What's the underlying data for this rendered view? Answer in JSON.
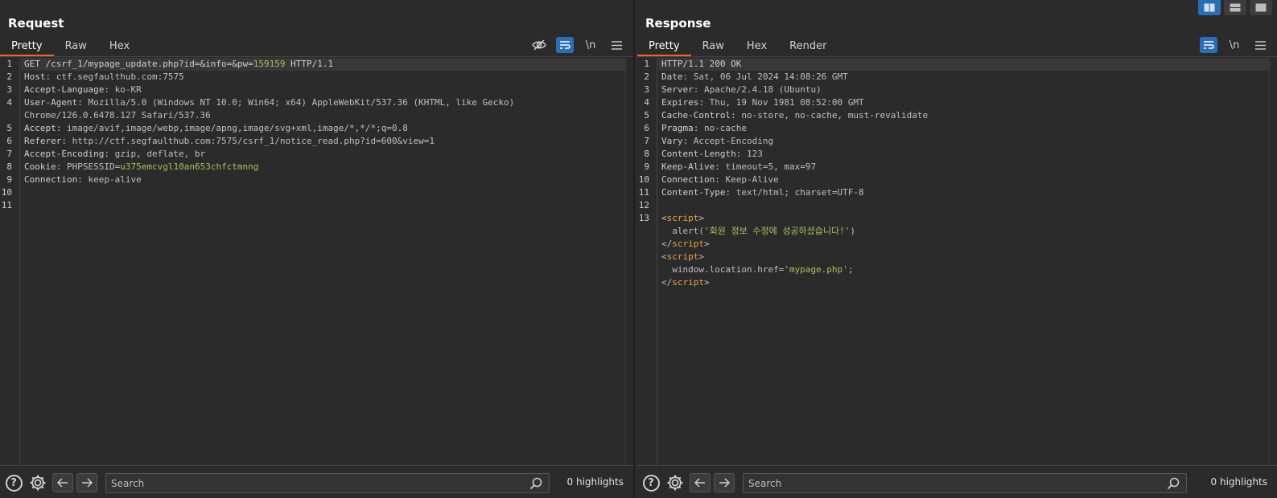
{
  "request": {
    "title": "Request",
    "tabs": [
      "Pretty",
      "Raw",
      "Hex"
    ],
    "active_tab": "Pretty",
    "lines": [
      {
        "n": "1",
        "parts": [
          [
            "k",
            "GET /csrf_1/mypage_update.php?id=&info=&pw="
          ],
          [
            "g",
            "159159"
          ],
          [
            "k",
            " HTTP/1.1"
          ]
        ]
      },
      {
        "n": "2",
        "parts": [
          [
            "k",
            "Host"
          ],
          [
            "v",
            ": ctf.segfaulthub.com:7575"
          ]
        ]
      },
      {
        "n": "3",
        "parts": [
          [
            "k",
            "Accept-Language"
          ],
          [
            "v",
            ": ko-KR"
          ]
        ]
      },
      {
        "n": "4",
        "parts": [
          [
            "k",
            "User-Agent"
          ],
          [
            "v",
            ": Mozilla/5.0 (Windows NT 10.0; Win64; x64) AppleWebKit/537.36 (KHTML, like Gecko)"
          ]
        ]
      },
      {
        "n": "",
        "parts": [
          [
            "v",
            "Chrome/126.0.6478.127 Safari/537.36"
          ]
        ]
      },
      {
        "n": "5",
        "parts": [
          [
            "k",
            "Accept"
          ],
          [
            "v",
            ": image/avif,image/webp,image/apng,image/svg+xml,image/*,*/*;q=0.8"
          ]
        ]
      },
      {
        "n": "6",
        "parts": [
          [
            "k",
            "Referer"
          ],
          [
            "v",
            ": http://ctf.segfaulthub.com:7575/csrf_1/notice_read.php?id=600&view=1"
          ]
        ]
      },
      {
        "n": "7",
        "parts": [
          [
            "k",
            "Accept-Encoding"
          ],
          [
            "v",
            ": gzip, deflate, br"
          ]
        ]
      },
      {
        "n": "8",
        "parts": [
          [
            "k",
            "Cookie"
          ],
          [
            "v",
            ": PHPSESSID="
          ],
          [
            "g",
            "u375emcvgl10an653chfctmnng"
          ]
        ]
      },
      {
        "n": "9",
        "parts": [
          [
            "k",
            "Connection"
          ],
          [
            "v",
            ": keep-alive"
          ]
        ]
      },
      {
        "n": "10",
        "parts": []
      },
      {
        "n": "11",
        "parts": []
      }
    ],
    "search_placeholder": "Search",
    "highlights": "0 highlights"
  },
  "response": {
    "title": "Response",
    "tabs": [
      "Pretty",
      "Raw",
      "Hex",
      "Render"
    ],
    "active_tab": "Pretty",
    "lines": [
      {
        "n": "1",
        "parts": [
          [
            "k",
            "HTTP/1.1 200 OK"
          ]
        ]
      },
      {
        "n": "2",
        "parts": [
          [
            "k",
            "Date"
          ],
          [
            "v",
            ": Sat, 06 Jul 2024 14:08:26 GMT"
          ]
        ]
      },
      {
        "n": "3",
        "parts": [
          [
            "k",
            "Server"
          ],
          [
            "v",
            ": Apache/2.4.18 (Ubuntu)"
          ]
        ]
      },
      {
        "n": "4",
        "parts": [
          [
            "k",
            "Expires"
          ],
          [
            "v",
            ": Thu, 19 Nov 1981 08:52:00 GMT"
          ]
        ]
      },
      {
        "n": "5",
        "parts": [
          [
            "k",
            "Cache-Control"
          ],
          [
            "v",
            ": no-store, no-cache, must-revalidate"
          ]
        ]
      },
      {
        "n": "6",
        "parts": [
          [
            "k",
            "Pragma"
          ],
          [
            "v",
            ": no-cache"
          ]
        ]
      },
      {
        "n": "7",
        "parts": [
          [
            "k",
            "Vary"
          ],
          [
            "v",
            ": Accept-Encoding"
          ]
        ]
      },
      {
        "n": "8",
        "parts": [
          [
            "k",
            "Content-Length"
          ],
          [
            "v",
            ": 123"
          ]
        ]
      },
      {
        "n": "9",
        "parts": [
          [
            "k",
            "Keep-Alive"
          ],
          [
            "v",
            ": timeout=5, max=97"
          ]
        ]
      },
      {
        "n": "10",
        "parts": [
          [
            "k",
            "Connection"
          ],
          [
            "v",
            ": Keep-Alive"
          ]
        ]
      },
      {
        "n": "11",
        "parts": [
          [
            "k",
            "Content-Type"
          ],
          [
            "v",
            ": text/html; charset=UTF-8"
          ]
        ]
      },
      {
        "n": "12",
        "parts": []
      },
      {
        "n": "13",
        "parts": [
          [
            "v",
            "<"
          ],
          [
            "t",
            "script"
          ],
          [
            "v",
            ">"
          ]
        ]
      },
      {
        "n": "",
        "parts": [
          [
            "v",
            "  alert("
          ],
          [
            "s",
            "'회원 정보 수정에 성공하셨습니다!'"
          ],
          [
            "v",
            ")"
          ]
        ]
      },
      {
        "n": "",
        "parts": [
          [
            "v",
            "</"
          ],
          [
            "t",
            "script"
          ],
          [
            "v",
            ">"
          ]
        ]
      },
      {
        "n": "",
        "parts": [
          [
            "v",
            "<"
          ],
          [
            "t",
            "script"
          ],
          [
            "v",
            ">"
          ]
        ]
      },
      {
        "n": "",
        "parts": [
          [
            "v",
            "  window.location.href="
          ],
          [
            "s",
            "'mypage.php'"
          ],
          [
            "v",
            ";"
          ]
        ]
      },
      {
        "n": "",
        "parts": [
          [
            "v",
            "</"
          ],
          [
            "t",
            "script"
          ],
          [
            "v",
            ">"
          ]
        ]
      }
    ],
    "search_placeholder": "Search",
    "highlights": "0 highlights"
  },
  "colors": {
    "accent": "#e8672b",
    "toggle_on": "#2d6db5",
    "value_green": "#a5c261",
    "tag_orange": "#e8a447"
  },
  "icons": [
    "hide-icon",
    "wrap-icon",
    "newline-icon",
    "menu-icon",
    "help-icon",
    "gear-icon",
    "arrow-left-icon",
    "arrow-right-icon",
    "search-icon",
    "layout-side-icon",
    "layout-stack-icon",
    "layout-single-icon"
  ],
  "newline_label": "\\n"
}
